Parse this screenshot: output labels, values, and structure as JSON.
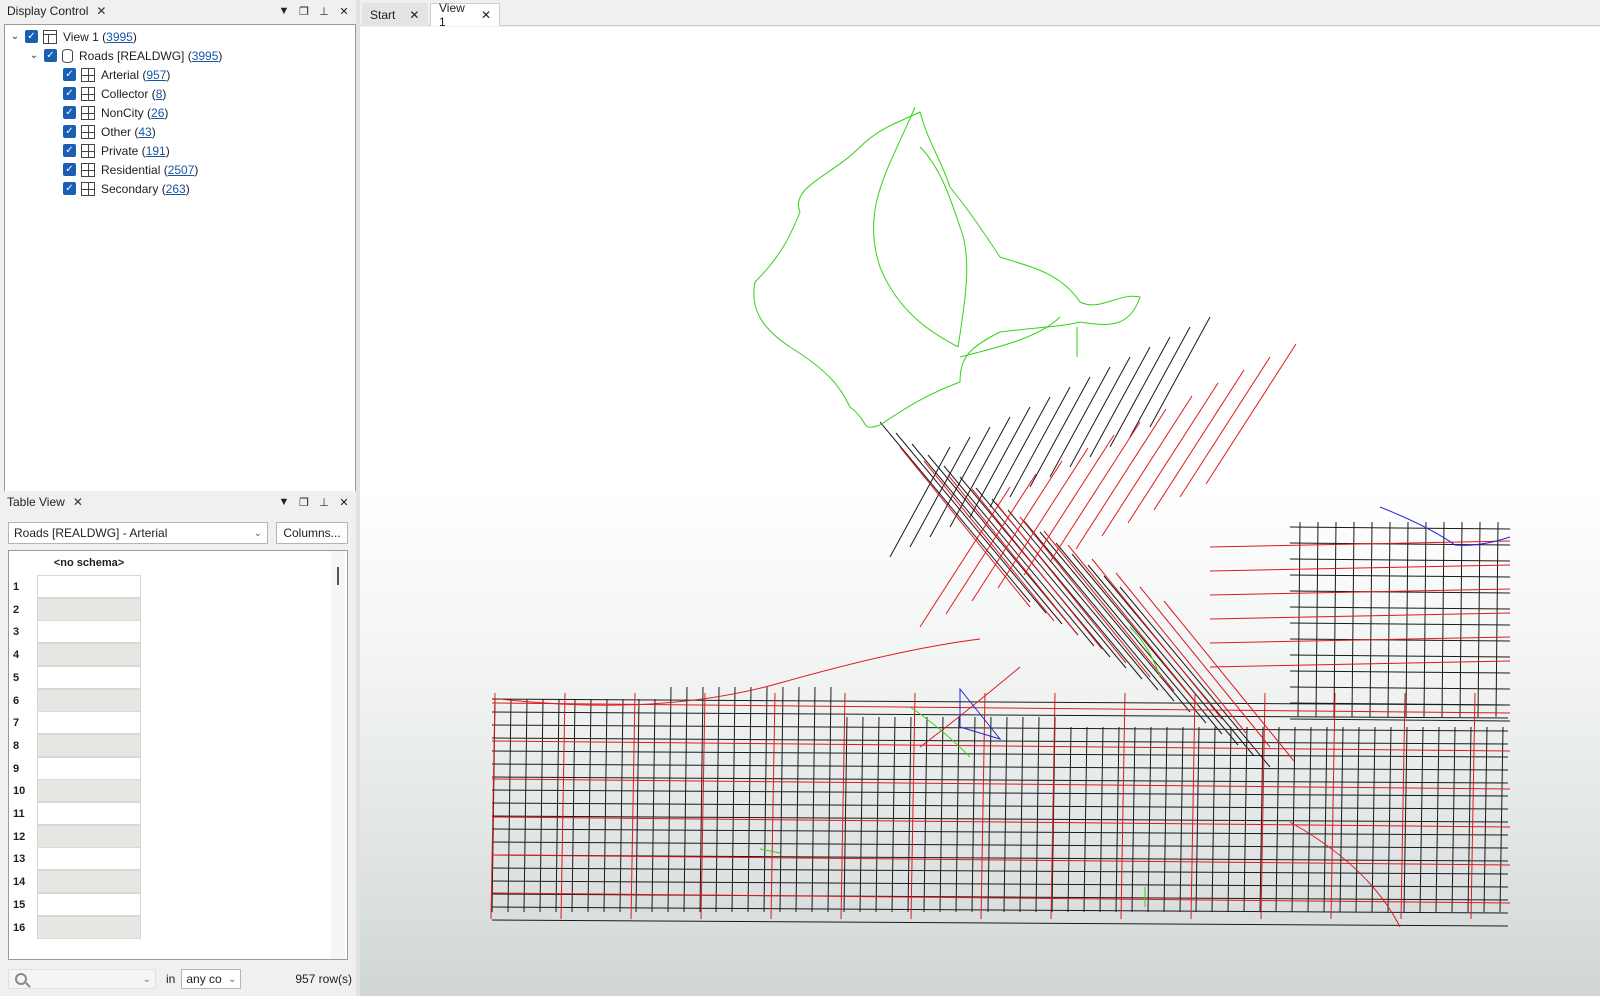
{
  "display_control": {
    "title": "Display Control",
    "close": "✕",
    "view": {
      "label": "View 1 (",
      "count": "3995",
      "suffix": ")"
    },
    "source": {
      "label": "Roads [REALDWG] (",
      "count": "3995",
      "suffix": ")"
    },
    "layers": [
      {
        "label": "Arterial (",
        "count": "957",
        "suffix": ")"
      },
      {
        "label": "Collector (",
        "count": "8",
        "suffix": ")"
      },
      {
        "label": "NonCity (",
        "count": "26",
        "suffix": ")"
      },
      {
        "label": "Other (",
        "count": "43",
        "suffix": ")"
      },
      {
        "label": "Private (",
        "count": "191",
        "suffix": ")"
      },
      {
        "label": "Residential (",
        "count": "2507",
        "suffix": ")"
      },
      {
        "label": "Secondary (",
        "count": "263",
        "suffix": ")"
      }
    ]
  },
  "table_view": {
    "title": "Table View",
    "close": "✕",
    "source_select": "Roads [REALDWG] - Arterial",
    "columns_button": "Columns...",
    "column_header": "<no schema>",
    "rows": [
      "1",
      "2",
      "3",
      "4",
      "5",
      "6",
      "7",
      "8",
      "9",
      "10",
      "11",
      "12",
      "13",
      "14",
      "15",
      "16"
    ],
    "in_label": "in",
    "in_select": "any co",
    "row_count": "957 row(s)"
  },
  "tabs": [
    {
      "label": "Start",
      "close": "✕"
    },
    {
      "label": "View 1",
      "close": "✕"
    }
  ],
  "colors": {
    "arterial": "#e0191c",
    "residential": "#1a1a1a",
    "park": "#36d11a",
    "other": "#2323d6",
    "accent": "#1a5fb4"
  }
}
